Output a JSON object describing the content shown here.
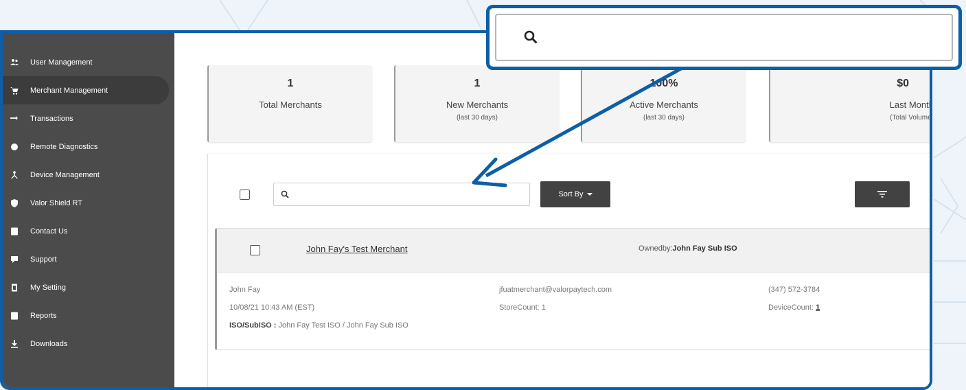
{
  "sidebar": {
    "items": [
      {
        "label": "User Management",
        "icon": "users-icon"
      },
      {
        "label": "Merchant Management",
        "icon": "cart-icon",
        "active": true
      },
      {
        "label": "Transactions",
        "icon": "transfer-icon"
      },
      {
        "label": "Remote Diagnostics",
        "icon": "diagnostics-icon"
      },
      {
        "label": "Device Management",
        "icon": "device-tree-icon"
      },
      {
        "label": "Valor Shield RT",
        "icon": "shield-icon"
      },
      {
        "label": "Contact Us",
        "icon": "contact-icon"
      },
      {
        "label": "Support",
        "icon": "support-icon"
      },
      {
        "label": "My Setting",
        "icon": "settings-icon"
      },
      {
        "label": "Reports",
        "icon": "reports-icon"
      },
      {
        "label": "Downloads",
        "icon": "download-icon"
      }
    ]
  },
  "stats": [
    {
      "value": "1",
      "label": "Total Merchants",
      "sub": ""
    },
    {
      "value": "1",
      "label": "New Merchants",
      "sub": "(last 30 days)"
    },
    {
      "value": "100%",
      "label": "Active Merchants",
      "sub": "(last 30 days)"
    },
    {
      "value": "$0",
      "label": "Last Month",
      "sub": "(Total Volume)"
    }
  ],
  "toolbar": {
    "search_placeholder": "",
    "sort_label": "Sort By"
  },
  "callout_search": {
    "placeholder": ""
  },
  "merchant": {
    "name": "John Fay's Test Merchant",
    "owned_by_prefix": "Ownedby:",
    "owned_by": "John Fay Sub ISO",
    "contact": "John Fay",
    "created": "10/08/21 10:43 AM (EST)",
    "iso_label": "ISO/SubISO :",
    "iso_value": "John Fay Test ISO / John Fay Sub ISO",
    "email": "jfuatmerchant@valorpaytech.com",
    "store_count_label": "StoreCount:",
    "store_count": "1",
    "phone": "(347) 572-3784",
    "device_count_label": "DeviceCount:",
    "device_count": "1"
  },
  "colors": {
    "accent": "#0d5ea8",
    "sidebar_bg": "#4b4b4b",
    "button_dark": "#424242"
  }
}
